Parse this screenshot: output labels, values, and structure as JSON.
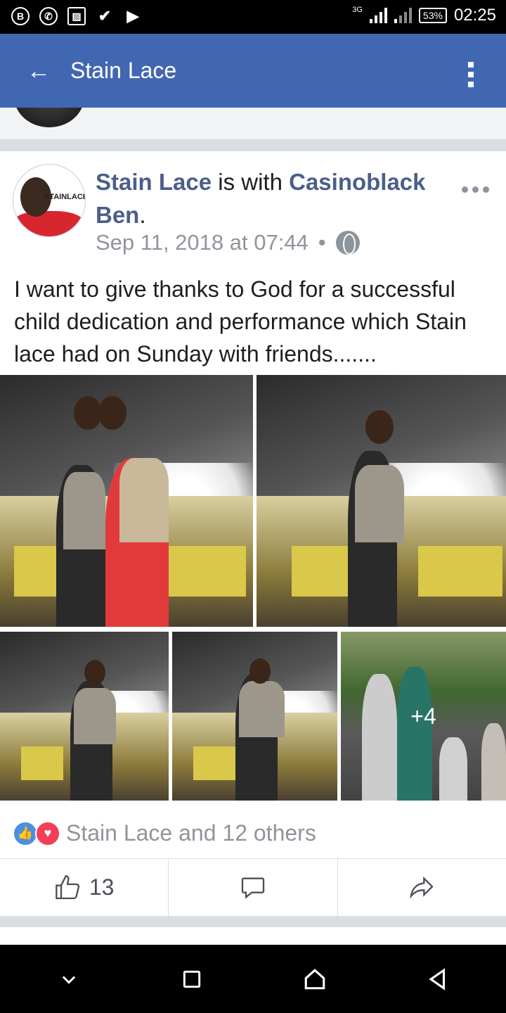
{
  "status_bar": {
    "time": "02:25",
    "battery": "53%",
    "network": "3G",
    "icons": [
      "b-icon",
      "whatsapp-icon",
      "gallery-icon",
      "check-icon",
      "play-check-icon"
    ]
  },
  "app_bar": {
    "title": "Stain Lace",
    "back_icon": "arrow-left-icon",
    "menu_icon": "more-vertical-icon"
  },
  "post": {
    "author": "Stain Lace",
    "with_text": " is with ",
    "tagged": "Casinoblack Ben",
    "period": ".",
    "timestamp": "Sep 11, 2018 at 07:44",
    "separator": "•",
    "privacy_icon": "globe-icon",
    "text": "I want to give thanks to God for a successful child dedication and performance  which Stain lace had on Sunday with friends.......",
    "avatar_text": "STAINLACE",
    "photos_more": "+4",
    "reactions_text": "Stain Lace and 12 others",
    "like_count": "13"
  },
  "colors": {
    "brand": "#4267b2",
    "name_link": "#4b5f8a",
    "meta": "#90949c"
  }
}
